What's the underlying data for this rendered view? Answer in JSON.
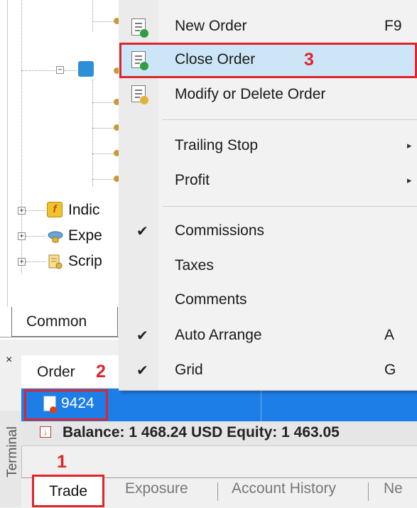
{
  "navigator": {
    "items": [
      {
        "label": "Indic",
        "icon": "indicators-icon"
      },
      {
        "label": "Expe",
        "icon": "experts-icon"
      },
      {
        "label": "Scrip",
        "icon": "scripts-icon"
      }
    ],
    "tab_label": "Common"
  },
  "context_menu": {
    "items": [
      {
        "label": "New Order",
        "shortcut": "F9",
        "icon": "new-order-icon"
      },
      {
        "label": "Close Order",
        "highlighted": true,
        "icon": "close-order-icon"
      },
      {
        "label": "Modify or Delete Order",
        "icon": "modify-order-icon"
      },
      {
        "label": "Trailing Stop",
        "submenu": true
      },
      {
        "label": "Profit",
        "submenu": true
      },
      {
        "label": "Commissions",
        "checked": true
      },
      {
        "label": "Taxes"
      },
      {
        "label": "Comments"
      },
      {
        "label": "Auto Arrange",
        "shortcut": "A",
        "checked": true
      },
      {
        "label": "Grid",
        "shortcut": "G",
        "checked": true
      }
    ]
  },
  "terminal": {
    "side_label": "Terminal",
    "close_glyph": "×",
    "column_header": "Order",
    "order_row": {
      "order_number": "9424"
    },
    "balance_text": "Balance: 1 468.24 USD  Equity: 1 463.05",
    "tabs": [
      "Trade",
      "Exposure",
      "Account History",
      "Ne"
    ]
  },
  "annotations": {
    "step1": "1",
    "step2": "2",
    "step3": "3",
    "color": "#e0242b"
  },
  "colors": {
    "selection": "#1e7ee8",
    "menu_highlight": "#cde6f7"
  }
}
